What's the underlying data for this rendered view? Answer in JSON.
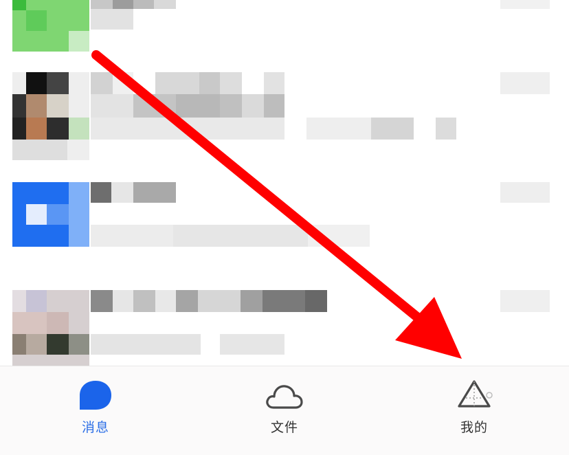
{
  "tabbar": {
    "tabs": [
      {
        "label": "消息",
        "icon": "message-bubble-icon",
        "active": true
      },
      {
        "label": "文件",
        "icon": "cloud-icon",
        "active": false
      },
      {
        "label": "我的",
        "icon": "profile-pyramid-icon",
        "active": false
      }
    ]
  },
  "colors": {
    "active_tab": "#2b6ee6",
    "annotation_arrow": "#ff0000"
  }
}
